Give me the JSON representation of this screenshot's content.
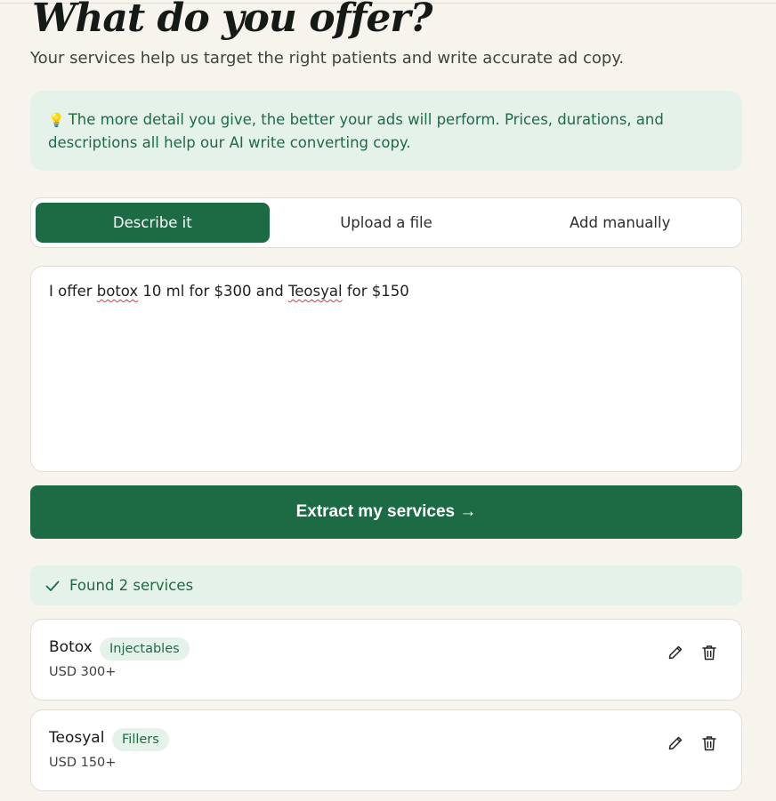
{
  "header": {
    "title": "What do you offer?",
    "subtitle": "Your services help us target the right patients and write accurate ad copy."
  },
  "tip": {
    "icon": "lightbulb-icon",
    "line1": "The more detail you give, the better your ads will perform. Prices, durations, and",
    "line2": "descriptions all help our AI write converting copy."
  },
  "tabs": [
    {
      "label": "Describe it",
      "active": true
    },
    {
      "label": "Upload a file",
      "active": false
    },
    {
      "label": "Add manually",
      "active": false
    }
  ],
  "description": {
    "part1": "I offer ",
    "word_botox": "botox",
    "part2": " 10 ml for $300 and ",
    "word_teosyal": "Teosyal",
    "part3": " for $150"
  },
  "extract_button": {
    "label": "Extract my services →"
  },
  "results": {
    "found_label": "Found 2 services"
  },
  "services": [
    {
      "name": "Botox",
      "category": "Injectables",
      "price": "USD 300+"
    },
    {
      "name": "Teosyal",
      "category": "Fillers",
      "price": "USD 150+"
    }
  ],
  "colors": {
    "brand": "#1c6b44",
    "tint": "#e5f2ea",
    "background": "#f7f4ee"
  }
}
